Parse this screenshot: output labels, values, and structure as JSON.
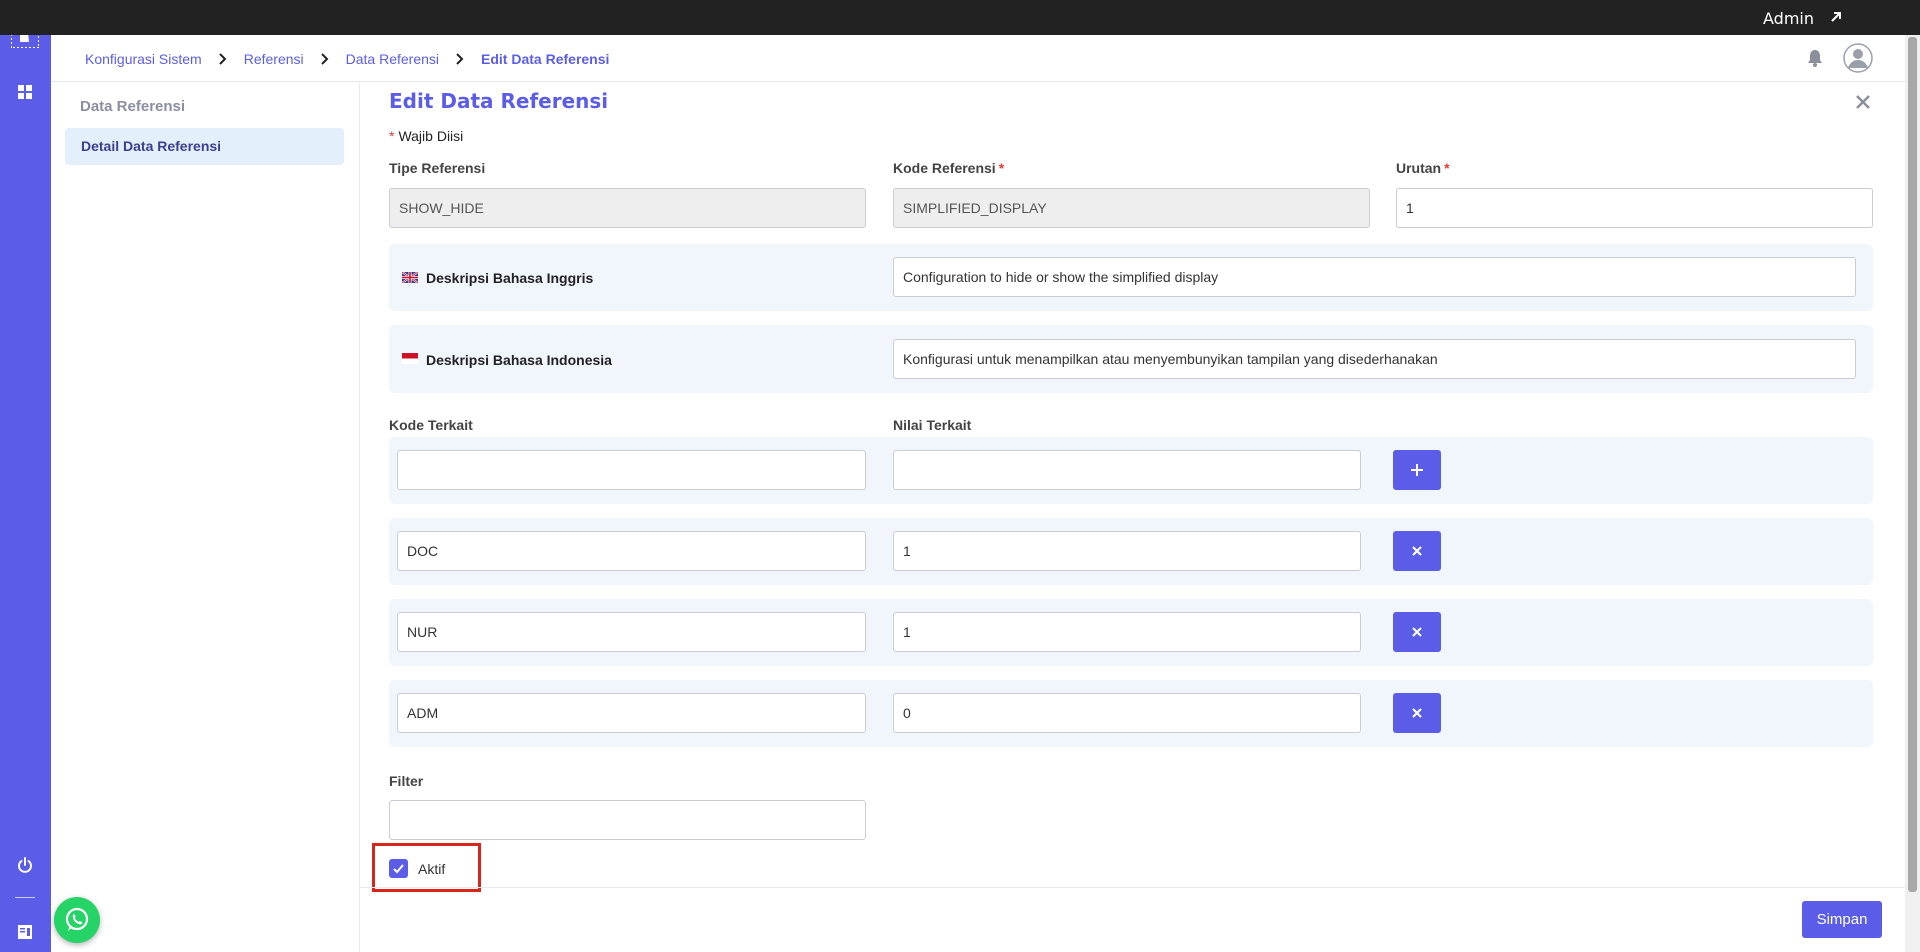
{
  "topbar": {
    "user_label": "Admin"
  },
  "breadcrumb": [
    "Konfigurasi Sistem",
    "Referensi",
    "Data Referensi",
    "Edit Data Referensi"
  ],
  "sidepanel": {
    "section_title": "Data Referensi",
    "active_item": "Detail Data Referensi"
  },
  "form": {
    "title": "Edit Data Referensi",
    "required_note": "Wajib Diisi",
    "tipe_label": "Tipe Referensi",
    "tipe_value": "SHOW_HIDE",
    "kode_label": "Kode Referensi",
    "kode_value": "SIMPLIFIED_DISPLAY",
    "urutan_label": "Urutan",
    "urutan_value": "1",
    "desc_en_label": "Deskripsi Bahasa Inggris",
    "desc_en_value": "Configuration to hide or show the simplified display",
    "desc_id_label": "Deskripsi Bahasa Indonesia",
    "desc_id_value": "Konfigurasi untuk menampilkan atau menyembunyikan tampilan yang disederhanakan",
    "kode_terkait_label": "Kode Terkait",
    "nilai_terkait_label": "Nilai Terkait",
    "related_rows": [
      {
        "kode": "",
        "nilai": ""
      },
      {
        "kode": "DOC",
        "nilai": "1"
      },
      {
        "kode": "NUR",
        "nilai": "1"
      },
      {
        "kode": "ADM",
        "nilai": "0"
      }
    ],
    "filter_label": "Filter",
    "filter_value": "",
    "aktif_label": "Aktif",
    "aktif_checked": true,
    "save_label": "Simpan"
  },
  "colors": {
    "accent": "#5b5de8",
    "topbar": "#222222",
    "band": "#f0f6fc",
    "highlight": "#d9261c"
  }
}
